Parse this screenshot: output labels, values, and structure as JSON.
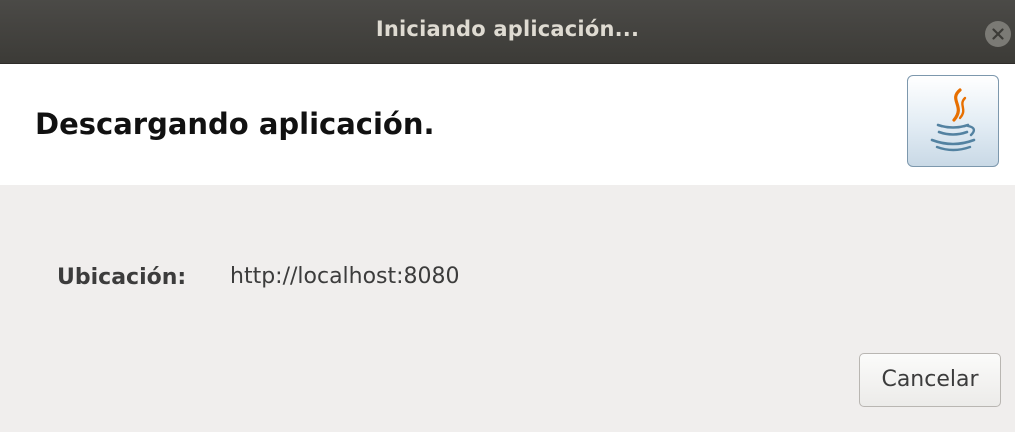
{
  "window": {
    "title": "Iniciando aplicación..."
  },
  "header": {
    "heading": "Descargando aplicación.",
    "logo_icon": "java-coffee-cup-icon"
  },
  "body": {
    "location_label": "Ubicación:",
    "location_value": "http://localhost:8080"
  },
  "buttons": {
    "cancel_label": "Cancelar"
  },
  "colors": {
    "titlebar": "#3c3b37",
    "title_text": "#dfdbd2",
    "java_red": "#e76f00",
    "java_blue": "#5382a1"
  }
}
